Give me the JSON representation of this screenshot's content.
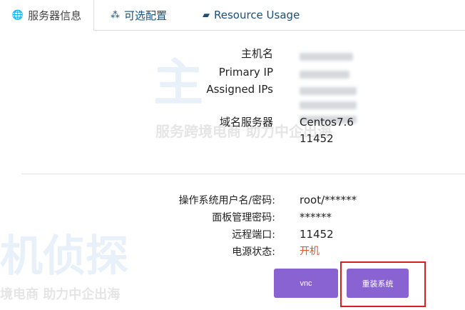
{
  "tabs": [
    {
      "label": "服务器信息",
      "icon": "globe-icon"
    },
    {
      "label": "可选配置",
      "icon": "cubes-icon"
    },
    {
      "label": "Resource Usage",
      "icon": "inbox-icon"
    }
  ],
  "info": {
    "hostname_label": "主机名",
    "primary_ip_label": "Primary IP",
    "assigned_ips_label": "Assigned IPs",
    "ns_label": "域名服务器",
    "ns_value1": "Centos7.6",
    "ns_value2": "11452"
  },
  "access": {
    "user_label": "操作系统用户名/密码:",
    "user_value": "root/******",
    "panel_label": "面板管理密码:",
    "panel_value": "******",
    "port_label": "远程端口:",
    "port_value": "11452",
    "power_label": "电源状态:",
    "power_value": "开机"
  },
  "buttons": {
    "vnc": "vnc",
    "reinstall": "重装系统"
  },
  "watermark": {
    "brand": "主机侦探",
    "slogan": "服务跨境电商 助力中企出海"
  },
  "colors": {
    "accent": "#8a63d2",
    "power_on": "#e0562a",
    "highlight": "#d42020"
  }
}
